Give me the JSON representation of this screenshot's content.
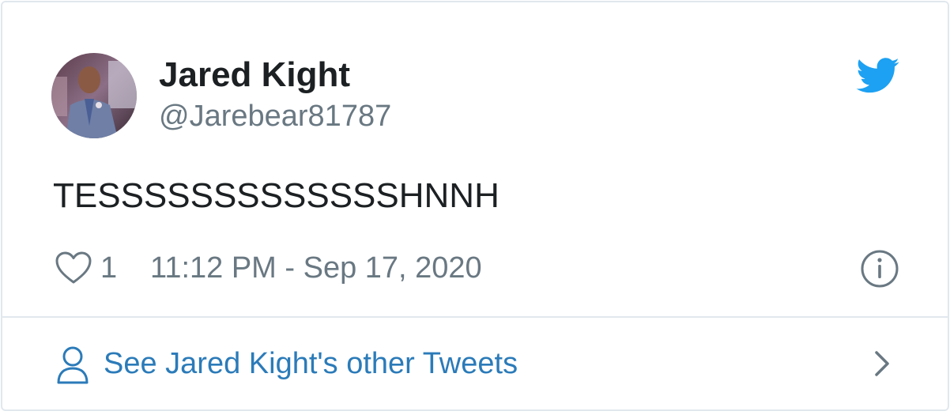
{
  "tweet": {
    "display_name": "Jared Kight",
    "handle": "@Jarebear81787",
    "text": "TESSSSSSSSSSSSSHNNH",
    "like_count": "1",
    "timestamp": "11:12 PM - Sep 17, 2020",
    "more_tweets_label": "See Jared Kight's other Tweets"
  },
  "icons": {
    "brand": "twitter-bird-icon",
    "like": "heart-icon",
    "info": "info-icon",
    "profile": "user-icon",
    "navigate": "chevron-right-icon"
  },
  "colors": {
    "brand": "#1da1f2",
    "link": "#2b7bb9",
    "text": "#1c2022",
    "muted": "#697882",
    "border": "#e1e8ed"
  }
}
